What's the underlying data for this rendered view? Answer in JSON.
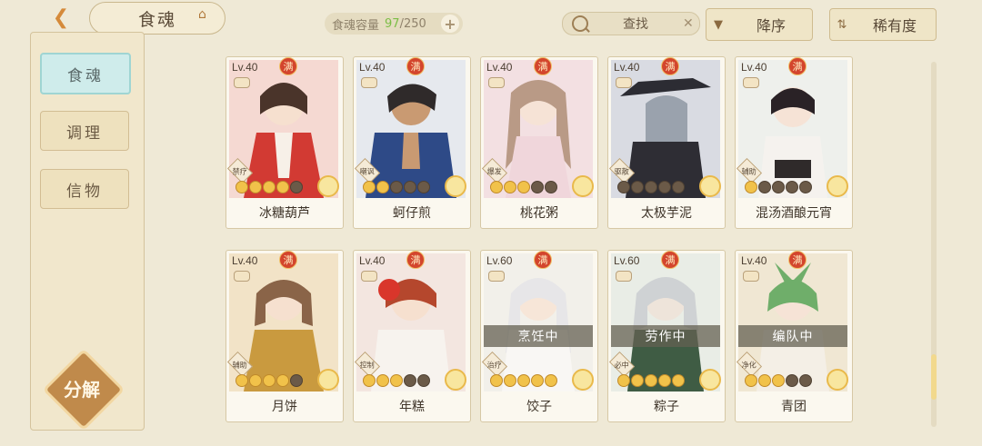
{
  "header": {
    "title": "食魂",
    "capacity_label": "食魂容量",
    "capacity_current": "97",
    "capacity_max": "/250",
    "capacity_add": "+",
    "search_label": "查找",
    "sort_order_label": "降序",
    "sort_by_label": "稀有度"
  },
  "sidebar": {
    "tabs": [
      {
        "label": "食魂",
        "active": true
      },
      {
        "label": "调理",
        "active": false
      },
      {
        "label": "信物",
        "active": false
      }
    ],
    "decompose_label": "分解"
  },
  "cards": [
    {
      "level": "Lv.40",
      "maxed": "满",
      "role": "禁疗",
      "name": "冰糖葫芦",
      "stars": 5,
      "status": ""
    },
    {
      "level": "Lv.40",
      "maxed": "满",
      "role": "嘲讽",
      "name": "蚵仔煎",
      "stars": 5,
      "status": ""
    },
    {
      "level": "Lv.40",
      "maxed": "满",
      "role": "爆发",
      "name": "桃花粥",
      "stars": 5,
      "status": ""
    },
    {
      "level": "Lv.40",
      "maxed": "满",
      "role": "驱散",
      "name": "太极芋泥",
      "stars": 5,
      "status": ""
    },
    {
      "level": "Lv.40",
      "maxed": "满",
      "role": "辅助",
      "name": "混汤酒酿元宵",
      "stars": 5,
      "status": ""
    },
    {
      "level": "Lv.40",
      "maxed": "满",
      "role": "辅助",
      "name": "月饼",
      "stars": 5,
      "status": ""
    },
    {
      "level": "Lv.40",
      "maxed": "满",
      "role": "控制",
      "name": "年糕",
      "stars": 5,
      "status": ""
    },
    {
      "level": "Lv.60",
      "maxed": "满",
      "role": "治疗",
      "name": "饺子",
      "stars": 5,
      "status": "烹饪中"
    },
    {
      "level": "Lv.60",
      "maxed": "满",
      "role": "必中",
      "name": "粽子",
      "stars": 5,
      "status": "劳作中"
    },
    {
      "level": "Lv.40",
      "maxed": "满",
      "role": "净化",
      "name": "青团",
      "stars": 5,
      "status": "编队中"
    }
  ],
  "colors": {
    "background": "#efe9d6",
    "active_tab": "#cfeceb",
    "maxed_badge": "#d3452d",
    "capacity_current": "#7bbd45"
  }
}
